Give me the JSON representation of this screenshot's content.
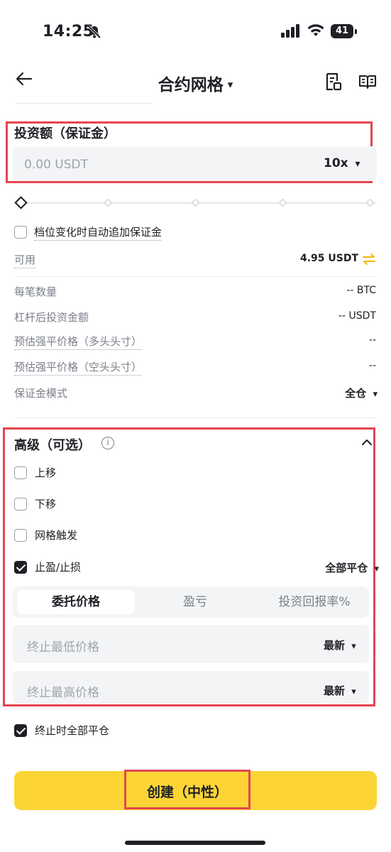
{
  "status_bar": {
    "time": "14:25",
    "battery": "41"
  },
  "header": {
    "title": "合约网格",
    "title_caret": "▾"
  },
  "investment": {
    "label": "投资额（保证金）",
    "placeholder": "0.00 USDT",
    "leverage": "10x",
    "caret": "▾"
  },
  "auto_margin": {
    "label": "档位变化时自动追加保证金",
    "checked": false
  },
  "available": {
    "label": "可用",
    "value": "4.95 USDT"
  },
  "details": [
    {
      "label": "每笔数量",
      "value": "-- BTC"
    },
    {
      "label": "杠杆后投资金额",
      "value": "-- USDT"
    },
    {
      "label": "预估强平价格（多头头寸）",
      "value": "--"
    },
    {
      "label": "预估强平价格（空头头寸）",
      "value": "--"
    }
  ],
  "margin_mode": {
    "label": "保证金模式",
    "value": "全仓",
    "caret": "▾"
  },
  "advanced": {
    "title": "高级（可选）",
    "info": "i",
    "options": [
      {
        "label": "上移",
        "checked": false
      },
      {
        "label": "下移",
        "checked": false
      },
      {
        "label": "网格触发",
        "checked": false
      },
      {
        "label": "止盈/止损",
        "checked": true
      }
    ],
    "tp_sl_mode": "全部平仓",
    "caret": "▾",
    "tabs": [
      "委托价格",
      "盈亏",
      "投资回报率%"
    ],
    "low_price": {
      "placeholder": "终止最低价格",
      "type": "最新"
    },
    "high_price": {
      "placeholder": "终止最高价格",
      "type": "最新"
    }
  },
  "close_all": {
    "label": "终止时全部平仓",
    "checked": true
  },
  "create_button": "创建（中性）",
  "colors": {
    "accent": "#fcd535",
    "highlight": "#e5454f",
    "swap_icon": "#f0b90b"
  }
}
